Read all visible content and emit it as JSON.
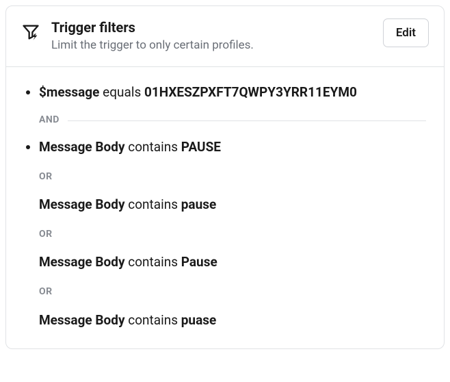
{
  "header": {
    "title": "Trigger filters",
    "subtitle": "Limit the trigger to only certain profiles.",
    "edit_label": "Edit"
  },
  "connectors": {
    "and": "AND",
    "or": "OR"
  },
  "filters": {
    "group1": {
      "field": "$message",
      "operator": "equals",
      "value": "01HXESZPXFT7QWPY3YRR11EYM0"
    },
    "group2": {
      "c0": {
        "field": "Message Body",
        "operator": "contains",
        "value": "PAUSE"
      },
      "c1": {
        "field": "Message Body",
        "operator": "contains",
        "value": "pause"
      },
      "c2": {
        "field": "Message Body",
        "operator": "contains",
        "value": "Pause"
      },
      "c3": {
        "field": "Message Body",
        "operator": "contains",
        "value": "puase"
      }
    }
  }
}
